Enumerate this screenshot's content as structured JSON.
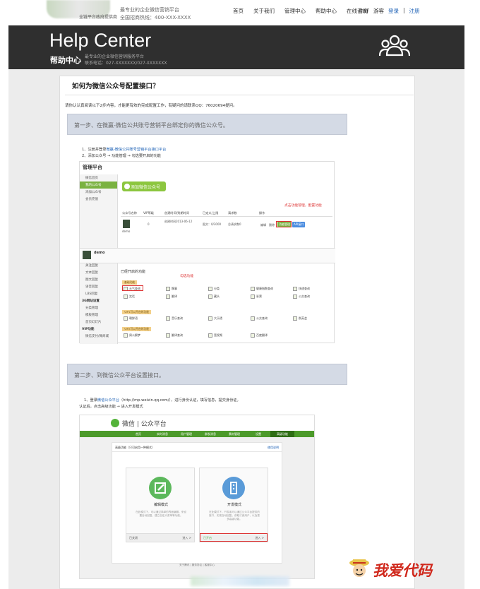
{
  "topbar": {
    "logo_text": "全链平台政府提供商",
    "slogan": "最专业的企业微信营销平台",
    "hotline": "全国招商热线：400-XXX-XXXX",
    "nav": [
      "首页",
      "关于我们",
      "管理中心",
      "帮助中心",
      "在线咨询"
    ],
    "greeting": "你好",
    "guest": "游客",
    "login": "登录",
    "sep": "|",
    "register": "注册"
  },
  "header": {
    "title": "Help Center",
    "cn_title": "帮助中心",
    "sub1": "最专业的企业微信营销服务平台",
    "sub2": "联系电话：027-XXXXXXX/027-XXXXXXX",
    "icon": "people-icon"
  },
  "article": {
    "title": "如何为微信公众号配置接口？",
    "intro": "请你认认真阅读以下2步内容，才能更有效的完成配置工作，有疑问的请联系QQ：76020694提问。",
    "step1": "第一步、在微赢-微信公共账号营销平台绑定你的微信公众号。",
    "step2": "第二步、到微信公众平台设置接口。"
  },
  "shot1": {
    "note1_prefix": "1、注册并登录",
    "note1_link": "微赢-微信公共账号营销平台接口平台",
    "note2": "2、添加公众号 → 功能管理 → 勾选要开启的功能",
    "panel_title": "管理平台",
    "side": [
      "微信首页",
      "我的公众号",
      "添加公众号",
      "会员充值"
    ],
    "add_btn": "添加微信公众号",
    "cols": [
      "公众号名称",
      "VIP等级",
      "创建时间/到期时间",
      "已定义/上限",
      "请求数",
      "操作"
    ],
    "row": {
      "name": "demo",
      "vip": "0",
      "dates": "创建时间2013-06-12",
      "quota": "图文：0/3000",
      "req": "总请求数0",
      "op1": "编辑",
      "op2": "删除",
      "btn1": "功能管理",
      "btn2": "API接口"
    },
    "red_note1": "点击功能管理，配置功能",
    "demo_name": "demo",
    "side2": [
      "基础设置",
      "功能配置",
      "关注回复",
      "文本回复",
      "图文回复",
      "语音回复",
      "LBS回复",
      "3G网站设置",
      "分类管理",
      "模板管理",
      "首页幻灯片",
      "VIP功能",
      "微信支付/微商城"
    ],
    "feat_title": "已经开启的功能",
    "red_note2": "勾选功能",
    "groups": [
      {
        "tag": "基础功能",
        "items": [
          "天气查询",
          "糗事",
          "分类",
          "健康指数查询",
          "快递查询",
          "笑话",
          "翻译",
          "藏头",
          "彩票",
          "公交查询"
        ]
      },
      {
        "tag": "VIP1可以开启的功能",
        "items": [
          "朝鲜语",
          "音乐查询",
          "大乐透",
          "公交查询",
          "群英会"
        ]
      },
      {
        "tag": "VIP2可以开启的功能",
        "items": [
          "周公解梦",
          "翻译查询",
          "宽视频",
          "百度翻译"
        ]
      }
    ]
  },
  "shot2": {
    "note1_prefix": "1、登录",
    "note1_link": "微信公众平台",
    "note1_suffix": "（http://mp.weixin.qq.com/），进行身份认证，填写信息，提交身份证。",
    "note2": "认证后，点击高级功能 → 进入开发模式",
    "brand": "微信 | 公众平台",
    "nav": [
      "首页",
      "实时消息",
      "用户管理",
      "群发消息",
      "素材管理",
      "设置",
      "高级功能"
    ],
    "body_title": "高级功能（只可启用一种模式）",
    "body_right": "使用说明",
    "mode1": {
      "title": "编辑模式",
      "desc": "在此模式下，可以通过简单的界面编辑，来设置自动回复，建立自定义菜单等功能。",
      "status": "已关闭",
      "enter": "进入 >"
    },
    "mode2": {
      "title": "开发模式",
      "desc": "在此模式下，开发者可以通过公众平台提供的接口，实现自动回复，获取订阅用户，以及更多高级功能。",
      "status": "已开启",
      "enter": "进入 >"
    },
    "footer": "关于腾讯 | 服务协议 | 客服中心"
  },
  "watermark": "我爱代码"
}
